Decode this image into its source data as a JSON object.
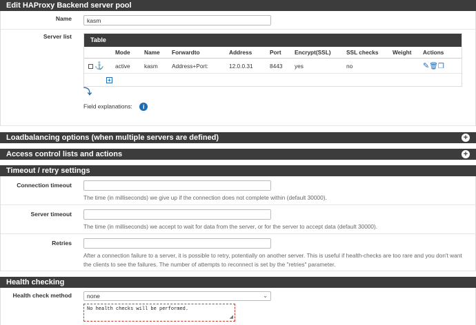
{
  "header": {
    "title": "Edit HAProxy Backend server pool"
  },
  "name_row": {
    "label": "Name",
    "value": "kasm"
  },
  "server_list": {
    "label": "Server list",
    "table_title": "Table",
    "columns": [
      "Mode",
      "Name",
      "Forwardto",
      "Address",
      "Port",
      "Encrypt(SSL)",
      "SSL checks",
      "Weight",
      "Actions"
    ],
    "rows": [
      {
        "mode": "active",
        "name": "kasm",
        "forwardto": "Address+Port:",
        "address": "12.0.0.31",
        "port": "8443",
        "encrypt": "yes",
        "ssl_checks": "no",
        "weight": ""
      }
    ],
    "field_explanations": "Field explanations:"
  },
  "collapsed_sections": {
    "loadbalancing": "Loadbalancing options (when multiple servers are defined)",
    "acl": "Access control lists and actions"
  },
  "timeout": {
    "title": "Timeout / retry settings",
    "connection": {
      "label": "Connection timeout",
      "value": "",
      "help": "The time (in milliseconds) we give up if the connection does not complete within (default 30000)."
    },
    "server": {
      "label": "Server timeout",
      "value": "",
      "help": "The time (in milliseconds) we accept to wait for data from the server, or for the server to accept data (default 30000)."
    },
    "retries": {
      "label": "Retries",
      "value": "",
      "help_line1": "After a connection failure to a server, it is possible to retry, potentially on another server. This is useful if health-checks are too rare and you don't want",
      "help_line2": "the clients to see the failures. The number of attempts to reconnect is set by the \"retries\" parameter."
    }
  },
  "health": {
    "title": "Health checking",
    "method_label": "Health check method",
    "method_value": "none",
    "description": "No health checks will be performed."
  },
  "colors": {
    "header_bg": "#3c3c3c",
    "accent": "#1f6ab4",
    "desc_border": "#c0392b"
  }
}
